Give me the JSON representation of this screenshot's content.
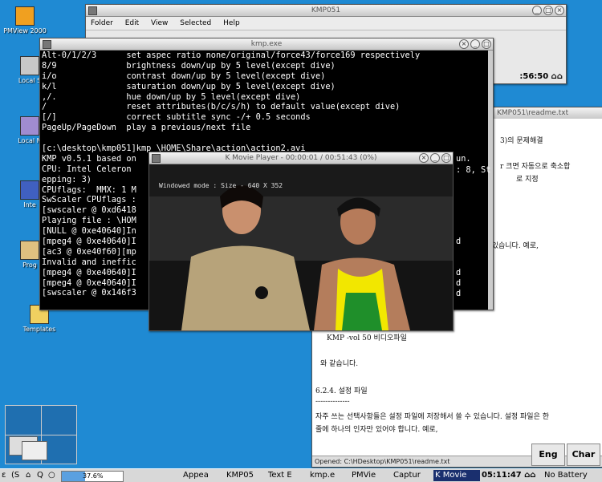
{
  "desktop": {
    "icons": [
      {
        "label": "PMView 2000",
        "color": "#f0a020"
      },
      {
        "label": "Local S",
        "color": "#c8c8c8"
      },
      {
        "label": "Local N",
        "color": "#a08cd0"
      },
      {
        "label": "Inte",
        "color": "#4060c0"
      },
      {
        "label": "Prog",
        "color": "#e0c080"
      },
      {
        "label": "Templates",
        "color": "#f0d060"
      }
    ]
  },
  "kmp_window": {
    "title": "KMP051",
    "menu": [
      "Folder",
      "Edit",
      "View",
      "Selected",
      "Help"
    ],
    "clock_fragment": ":56:50 ⌂⌂"
  },
  "terminal": {
    "title": "kmp.exe",
    "lines": [
      "Alt-0/1/2/3      set aspec ratio none/original/force43/force169 respectively",
      "8/9              brightness down/up by 5 level(except dive)",
      "i/o              contrast down/up by 5 level(except dive)",
      "k/l              saturation down/up by 5 level(except dive)",
      ",/.              hue down/up by 5 level(except dive)",
      "/                reset attributes(b/c/s/h) to default value(except dive)",
      "[/]              correct subtitle sync -/+ 0.5 seconds",
      "PageUp/PageDown  play a previous/next file",
      "",
      "[c:\\desktop\\kmp051]kmp \\HOME\\Share\\action\\action2.avi",
      "KMP v0.5.1 based on",
      "CPU: Intel Celeron",
      "epping: 3)",
      "CPUflags:  MMX: 1 M",
      "SwScaler CPUflags :",
      "[swscaler @ 0xd6418",
      "Playing file : \\HOM",
      "[NULL @ 0xe40640]In",
      "[mpeg4 @ 0xe40640]I",
      "[ac3 @ 0xe40f60][mp",
      "Invalid and ineffic",
      "[mpeg4 @ 0xe40640]I",
      "[mpeg4 @ 0xe40640]I",
      "[swscaler @ 0x146f3"
    ],
    "right_fragments": [
      "un.",
      ": 8, St",
      "d",
      "d",
      "d",
      "d"
    ]
  },
  "movie_player": {
    "title": "K Movie Player - 00:00:01 / 00:51:43 (0%)",
    "overlay": "Windowed mode : Size - 640 X 352"
  },
  "readme": {
    "title": "KMP051\\readme.txt",
    "lines": [
      "3)의 문제해결",
      "r 크면 자동으로 축소합",
      "로 지정",
      "d",
      "해서 쓸 수 있습니다. 예로,",
      "KMP -vol 50 비디오파일",
      "와 같습니다.",
      "6.2.4. 설정 파일",
      "--------------",
      "  자주 쓰는 선택사항들은 설정 파일에 저장해서 쓸 수 있습니다. 설정 파일은 한",
      "줄에 하나의 인자만 있어야 합니다. 예로,"
    ],
    "status": "Opened: C:\\HDesktop\\KMP051\\readme.txt"
  },
  "ime": {
    "eng": "Eng",
    "char": "Char"
  },
  "taskbar": {
    "tray_icons": [
      "ε",
      "(S",
      "⌂",
      "Q",
      "○"
    ],
    "cpu": "37.6%",
    "tasks": [
      {
        "label": "Appea",
        "active": false
      },
      {
        "label": "KMP05",
        "active": false
      },
      {
        "label": "Text E",
        "active": false
      },
      {
        "label": "kmp.e",
        "active": false
      },
      {
        "label": "PMVie",
        "active": false
      },
      {
        "label": "Captur",
        "active": false
      },
      {
        "label": "K Movie",
        "active": true
      }
    ],
    "clock": "05:11:47 ⌂⌂",
    "battery": "No Battery"
  }
}
